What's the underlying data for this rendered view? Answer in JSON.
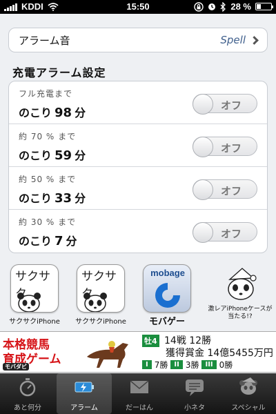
{
  "status": {
    "carrier": "KDDI",
    "time": "15:50",
    "battery": "28 %",
    "battery_level": 0.28
  },
  "alarm_sound": {
    "label": "アラーム音",
    "value": "Spell"
  },
  "charge_section": {
    "title": "充電アラーム設定",
    "rows": [
      {
        "sub": "フル充電まで",
        "prefix": "のこり",
        "value": "98",
        "unit": "分",
        "toggle": "オフ"
      },
      {
        "sub": "約 70 % まで",
        "prefix": "のこり",
        "value": "59",
        "unit": "分",
        "toggle": "オフ"
      },
      {
        "sub": "約 50 % まで",
        "prefix": "のこり",
        "value": "33",
        "unit": "分",
        "toggle": "オフ"
      },
      {
        "sub": "約 30 % まで",
        "prefix": "のこり",
        "value": "7",
        "unit": "分",
        "toggle": "オフ"
      }
    ]
  },
  "apps": [
    {
      "name": "サクサクiPhone",
      "icon_text": "サクサク"
    },
    {
      "name": "サクサクiPhone",
      "icon_text": "サクサク"
    },
    {
      "name": "モバゲー",
      "icon_text": "mobage"
    },
    {
      "name": "激レアiPhoneケースが当たる!?"
    }
  ],
  "ad": {
    "title1": "本格競馬",
    "title2": "育成ゲーム",
    "logo": "モバダビ",
    "badge": "牡4",
    "stats1": "14戦 12勝",
    "stats2": "獲得賞金 14億5455万円",
    "ranks": [
      {
        "grade": "I",
        "wins": "7勝"
      },
      {
        "grade": "II",
        "wins": "3勝"
      },
      {
        "grade": "III",
        "wins": "0勝"
      }
    ]
  },
  "tabs": [
    {
      "label": "あと何分",
      "icon": "stopwatch-icon"
    },
    {
      "label": "アラーム",
      "icon": "battery-charge-icon",
      "active": true
    },
    {
      "label": "だーはん",
      "icon": "envelope-icon"
    },
    {
      "label": "小ネタ",
      "icon": "speech-bubble-icon"
    },
    {
      "label": "スペシャル",
      "icon": "panda-icon"
    }
  ]
}
